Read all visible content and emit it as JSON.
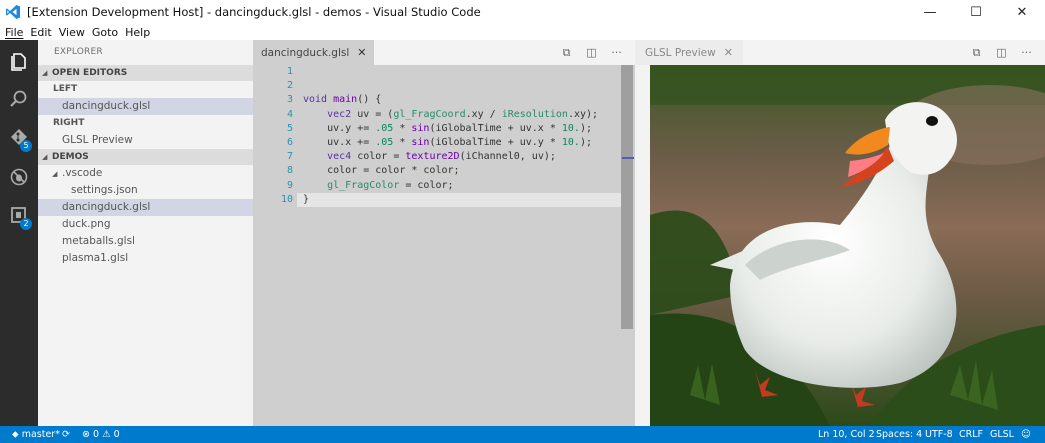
{
  "window": {
    "title": "[Extension Development Host] - dancingduck.glsl - demos - Visual Studio Code",
    "controls": {
      "minimize": "—",
      "maximize": "☐",
      "close": "✕"
    }
  },
  "menu": [
    "File",
    "Edit",
    "View",
    "Goto",
    "Help"
  ],
  "activity_bar": {
    "items": [
      {
        "name": "explorer-icon"
      },
      {
        "name": "search-icon"
      },
      {
        "name": "git-icon",
        "badge": "5"
      },
      {
        "name": "debug-icon"
      },
      {
        "name": "extensions-icon",
        "badge": "2"
      }
    ]
  },
  "sidebar": {
    "header": "EXPLORER",
    "open_editors": {
      "title": "OPEN EDITORS",
      "groups": [
        {
          "label": "LEFT",
          "items": [
            "dancingduck.glsl"
          ]
        },
        {
          "label": "RIGHT",
          "items": [
            "GLSL Preview"
          ]
        }
      ]
    },
    "folder": {
      "title": "DEMOS",
      "items": [
        {
          "label": ".vscode",
          "expanded": true
        },
        {
          "label": "settings.json"
        },
        {
          "label": "dancingduck.glsl",
          "selected": true
        },
        {
          "label": "duck.png"
        },
        {
          "label": "metaballs.glsl"
        },
        {
          "label": "plasma1.glsl"
        }
      ]
    }
  },
  "editor": {
    "tab": {
      "label": "dancingduck.glsl",
      "close": "✕"
    },
    "actions": [
      "⧉",
      "◫",
      "···"
    ],
    "line_numbers": [
      "1",
      "2",
      "3",
      "4",
      "5",
      "6",
      "7",
      "8",
      "9",
      "10"
    ],
    "lines": [
      "",
      "",
      "void main() {",
      "    vec2 uv = (gl_FragCoord.xy / iResolution.xy);",
      "    uv.y += .05 * sin(iGlobalTime + uv.x * 10.);",
      "    uv.x += .05 * sin(iGlobalTime + uv.y * 10.);",
      "    vec4 color = texture2D(iChannel0, uv);",
      "    color = color * color;",
      "    gl_FragColor = color;",
      "}"
    ]
  },
  "preview": {
    "tab": {
      "label": "GLSL Preview",
      "close": "✕"
    },
    "actions": [
      "⧉",
      "◫",
      "···"
    ]
  },
  "status_bar": {
    "branch": "master*",
    "sync": "⟳",
    "errors": "0",
    "warnings": "0",
    "position": "Ln 10, Col 2",
    "indent": "Spaces: 4",
    "encoding": "UTF-8",
    "eol": "CRLF",
    "language": "GLSL",
    "feedback": "☺"
  },
  "colors": {
    "accent": "#007acc",
    "activity_bar": "#2c2c2c",
    "sidebar": "#f3f3f3",
    "editor_bg": "#cfcfcf"
  }
}
